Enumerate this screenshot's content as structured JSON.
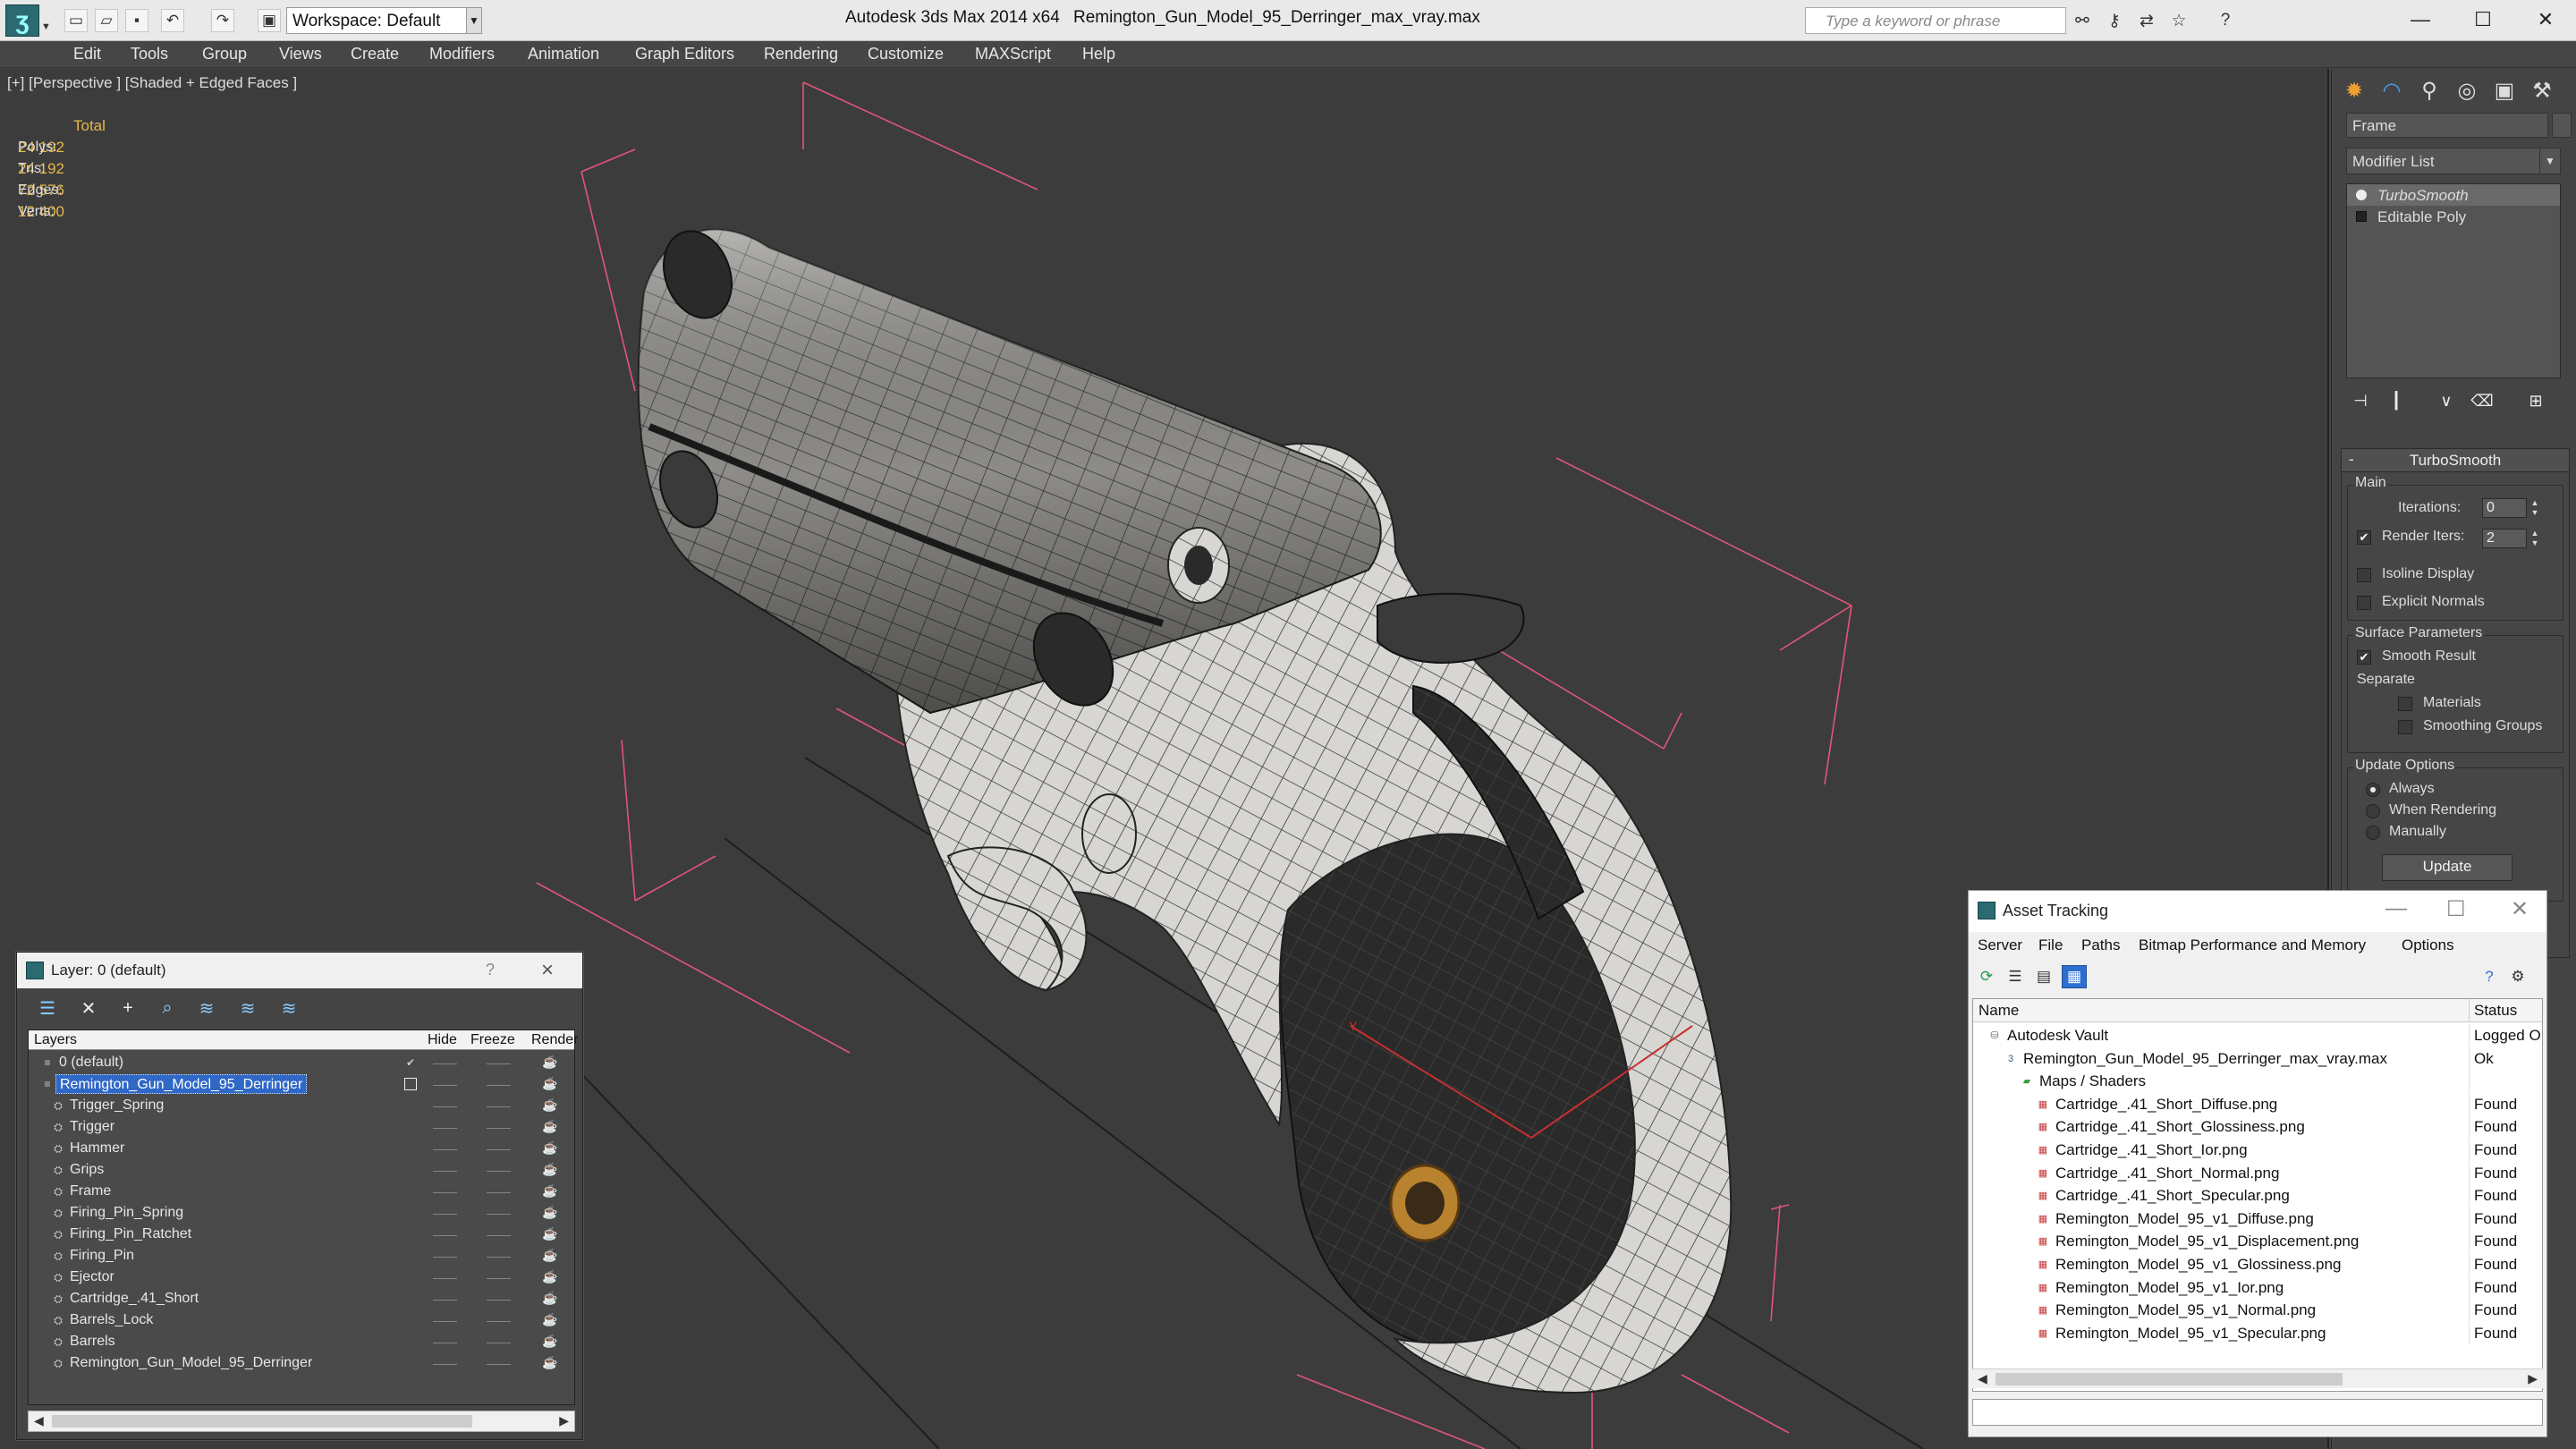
{
  "titlebar": {
    "workspace": "Workspace: Default",
    "app_title": "Autodesk 3ds Max  2014 x64",
    "file_title": "Remington_Gun_Model_95_Derringer_max_vray.max",
    "search_placeholder": "Type a keyword or phrase",
    "quick_access_icons": [
      "new-file-icon",
      "open-file-icon",
      "save-icon",
      "undo-icon",
      "redo-icon",
      "project-folder-icon"
    ],
    "tool_icons": [
      "binoculars-icon",
      "key-icon",
      "exchange-icon",
      "star-icon",
      "help-icon"
    ],
    "window_controls": [
      "minimize-icon",
      "maximize-icon",
      "close-icon"
    ]
  },
  "menu": [
    "Edit",
    "Tools",
    "Group",
    "Views",
    "Create",
    "Modifiers",
    "Animation",
    "Graph Editors",
    "Rendering",
    "Customize",
    "MAXScript",
    "Help"
  ],
  "viewport": {
    "label": "[+] [Perspective ] [Shaded + Edged Faces ]",
    "stats_header": "Total",
    "stats": [
      {
        "label": "Polys:",
        "value": "24 192"
      },
      {
        "label": "Tris:",
        "value": "24 192"
      },
      {
        "label": "Edges:",
        "value": "72 576"
      },
      {
        "label": "Verts:",
        "value": "12 400"
      }
    ],
    "axis_label": "Y"
  },
  "command_panel": {
    "tab_icons": [
      "create-tab-icon",
      "modify-tab-icon",
      "hierarchy-tab-icon",
      "motion-tab-icon",
      "display-tab-icon",
      "utilities-tab-icon"
    ],
    "object_name": "Frame",
    "modifier_list": "Modifier List",
    "stack": [
      {
        "label": "TurboSmooth",
        "selected": true
      },
      {
        "label": "Editable Poly",
        "selected": false
      }
    ],
    "stack_tool_icons": [
      "pin-stack-icon",
      "show-end-result-icon",
      "make-unique-icon",
      "remove-modifier-icon",
      "configure-sets-icon"
    ],
    "turbosmooth": {
      "title": "TurboSmooth",
      "collapse": "-",
      "main_label": "Main",
      "iterations_label": "Iterations:",
      "iterations_value": "0",
      "render_iters_label": "Render Iters:",
      "render_iters_value": "2",
      "isoline_label": "Isoline Display",
      "explicit_normals_label": "Explicit Normals",
      "surface_params_label": "Surface Parameters",
      "smooth_result_label": "Smooth Result",
      "separate_label": "Separate",
      "materials_label": "Materials",
      "smoothing_groups_label": "Smoothing Groups",
      "update_options_label": "Update Options",
      "always_label": "Always",
      "when_rendering_label": "When Rendering",
      "manually_label": "Manually",
      "update_button": "Update"
    }
  },
  "layer_dialog": {
    "title": "Layer: 0 (default)",
    "help": "?",
    "close": "×",
    "tool_icons": [
      "new-layer-icon",
      "delete-layer-icon",
      "add-to-layer-icon",
      "select-in-layer-icon",
      "highlight-layer-icon",
      "hide-all-icon",
      "freeze-all-icon"
    ],
    "columns": {
      "layers": "Layers",
      "hide": "Hide",
      "freeze": "Freeze",
      "render": "Render"
    },
    "rows": [
      {
        "name": "0 (default)",
        "level": 0,
        "kind": "layer",
        "active": true
      },
      {
        "name": "Remington_Gun_Model_95_Derringer",
        "level": 0,
        "kind": "layer",
        "selected": true
      },
      {
        "name": "Trigger_Spring",
        "level": 1,
        "kind": "object"
      },
      {
        "name": "Trigger",
        "level": 1,
        "kind": "object"
      },
      {
        "name": "Hammer",
        "level": 1,
        "kind": "object"
      },
      {
        "name": "Grips",
        "level": 1,
        "kind": "object"
      },
      {
        "name": "Frame",
        "level": 1,
        "kind": "object"
      },
      {
        "name": "Firing_Pin_Spring",
        "level": 1,
        "kind": "object"
      },
      {
        "name": "Firing_Pin_Ratchet",
        "level": 1,
        "kind": "object"
      },
      {
        "name": "Firing_Pin",
        "level": 1,
        "kind": "object"
      },
      {
        "name": "Ejector",
        "level": 1,
        "kind": "object"
      },
      {
        "name": "Cartridge_.41_Short",
        "level": 1,
        "kind": "object"
      },
      {
        "name": "Barrels_Lock",
        "level": 1,
        "kind": "object"
      },
      {
        "name": "Barrels",
        "level": 1,
        "kind": "object"
      },
      {
        "name": "Remington_Gun_Model_95_Derringer",
        "level": 1,
        "kind": "object"
      }
    ]
  },
  "asset_dialog": {
    "title": "Asset Tracking",
    "menu": [
      "Server",
      "File",
      "Paths",
      "Bitmap Performance and Memory",
      "Options"
    ],
    "tool_icons": [
      "refresh-icon",
      "list-view-icon",
      "thumbnail-view-icon",
      "table-view-icon",
      "help-icon",
      "settings-icon"
    ],
    "columns": {
      "name": "Name",
      "status": "Status"
    },
    "rows": [
      {
        "name": "Autodesk Vault",
        "status": "Logged O",
        "level": 0,
        "icon": "vault-icon"
      },
      {
        "name": "Remington_Gun_Model_95_Derringer_max_vray.max",
        "status": "Ok",
        "level": 1,
        "icon": "max-file-icon"
      },
      {
        "name": "Maps / Shaders",
        "status": "",
        "level": 2,
        "icon": "maps-folder-icon"
      },
      {
        "name": "Cartridge_.41_Short_Diffuse.png",
        "status": "Found",
        "level": 3,
        "icon": "png-icon"
      },
      {
        "name": "Cartridge_.41_Short_Glossiness.png",
        "status": "Found",
        "level": 3,
        "icon": "png-icon"
      },
      {
        "name": "Cartridge_.41_Short_Ior.png",
        "status": "Found",
        "level": 3,
        "icon": "png-icon"
      },
      {
        "name": "Cartridge_.41_Short_Normal.png",
        "status": "Found",
        "level": 3,
        "icon": "png-icon"
      },
      {
        "name": "Cartridge_.41_Short_Specular.png",
        "status": "Found",
        "level": 3,
        "icon": "png-icon"
      },
      {
        "name": "Remington_Model_95_v1_Diffuse.png",
        "status": "Found",
        "level": 3,
        "icon": "png-icon"
      },
      {
        "name": "Remington_Model_95_v1_Displacement.png",
        "status": "Found",
        "level": 3,
        "icon": "png-icon"
      },
      {
        "name": "Remington_Model_95_v1_Glossiness.png",
        "status": "Found",
        "level": 3,
        "icon": "png-icon"
      },
      {
        "name": "Remington_Model_95_v1_Ior.png",
        "status": "Found",
        "level": 3,
        "icon": "png-icon"
      },
      {
        "name": "Remington_Model_95_v1_Normal.png",
        "status": "Found",
        "level": 3,
        "icon": "png-icon"
      },
      {
        "name": "Remington_Model_95_v1_Specular.png",
        "status": "Found",
        "level": 3,
        "icon": "png-icon"
      }
    ]
  },
  "colors": {
    "selection": "#2f68c7",
    "stats_text": "#e6b84a",
    "bbox_lines": "#e0557a",
    "viewport_bg": "#3c3c3c"
  }
}
